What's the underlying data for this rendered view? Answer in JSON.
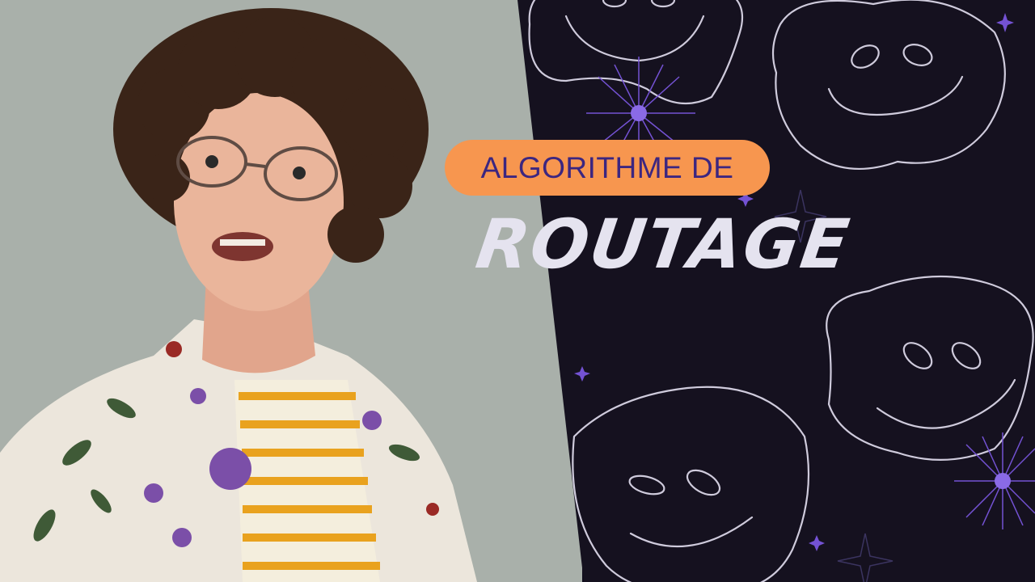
{
  "banner": {
    "subtitle": "ALGORITHME DE",
    "title": "ROUTAGE"
  },
  "colors": {
    "pill_background": "#f7964f",
    "pill_text": "#3c2680",
    "title_text": "#e5e3ef",
    "dark_background": "#15111f",
    "photo_background": "#a9b0aa",
    "accent_purple": "#7452d4"
  }
}
